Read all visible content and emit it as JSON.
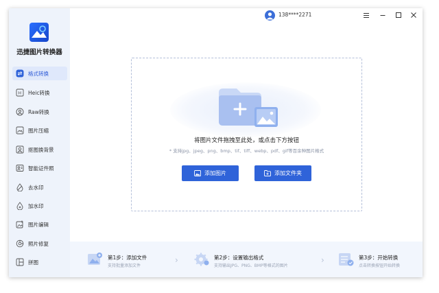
{
  "app": {
    "name": "迅捷图片转换器"
  },
  "titlebar": {
    "phone": "138****2271",
    "menu_icon": "menu-icon",
    "minimize_icon": "minimize-icon",
    "maximize_icon": "maximize-icon",
    "close_icon": "close-icon"
  },
  "sidebar": {
    "items": [
      {
        "label": "格式转换",
        "icon": "format-convert-icon",
        "active": true
      },
      {
        "label": "Heic转换",
        "icon": "heic-icon"
      },
      {
        "label": "Raw转换",
        "icon": "raw-icon"
      },
      {
        "label": "图片压缩",
        "icon": "compress-icon"
      },
      {
        "label": "抠图换背景",
        "icon": "cutout-icon"
      },
      {
        "label": "智能证件照",
        "icon": "id-photo-icon"
      },
      {
        "label": "去水印",
        "icon": "remove-watermark-icon"
      },
      {
        "label": "加水印",
        "icon": "add-watermark-icon"
      },
      {
        "label": "图片编辑",
        "icon": "image-edit-icon"
      },
      {
        "label": "照片修复",
        "icon": "photo-repair-icon"
      },
      {
        "label": "拼图",
        "icon": "collage-icon"
      }
    ]
  },
  "main": {
    "drop_text": "将图片文件拖拽至此处，或点击下方按钮",
    "formats_text": "* 支持jpg、jpeg、png、bmp、tif、tiff、webp、pdf、gif等百余种图片格式",
    "add_image_label": "添加图片",
    "add_folder_label": "添加文件夹"
  },
  "steps": [
    {
      "title": "第1步：添加文件",
      "desc": "支持批量添加文件"
    },
    {
      "title": "第2步：设置输出格式",
      "desc": "支持输出JPG、PNG、BMP等格式的图片"
    },
    {
      "title": "第3步：开始转换",
      "desc": "点击转换按钮开始转换"
    }
  ],
  "colors": {
    "accent": "#2f63d9",
    "sidebar_bg": "#eef3fb",
    "active_bg": "#dfe8fb"
  }
}
